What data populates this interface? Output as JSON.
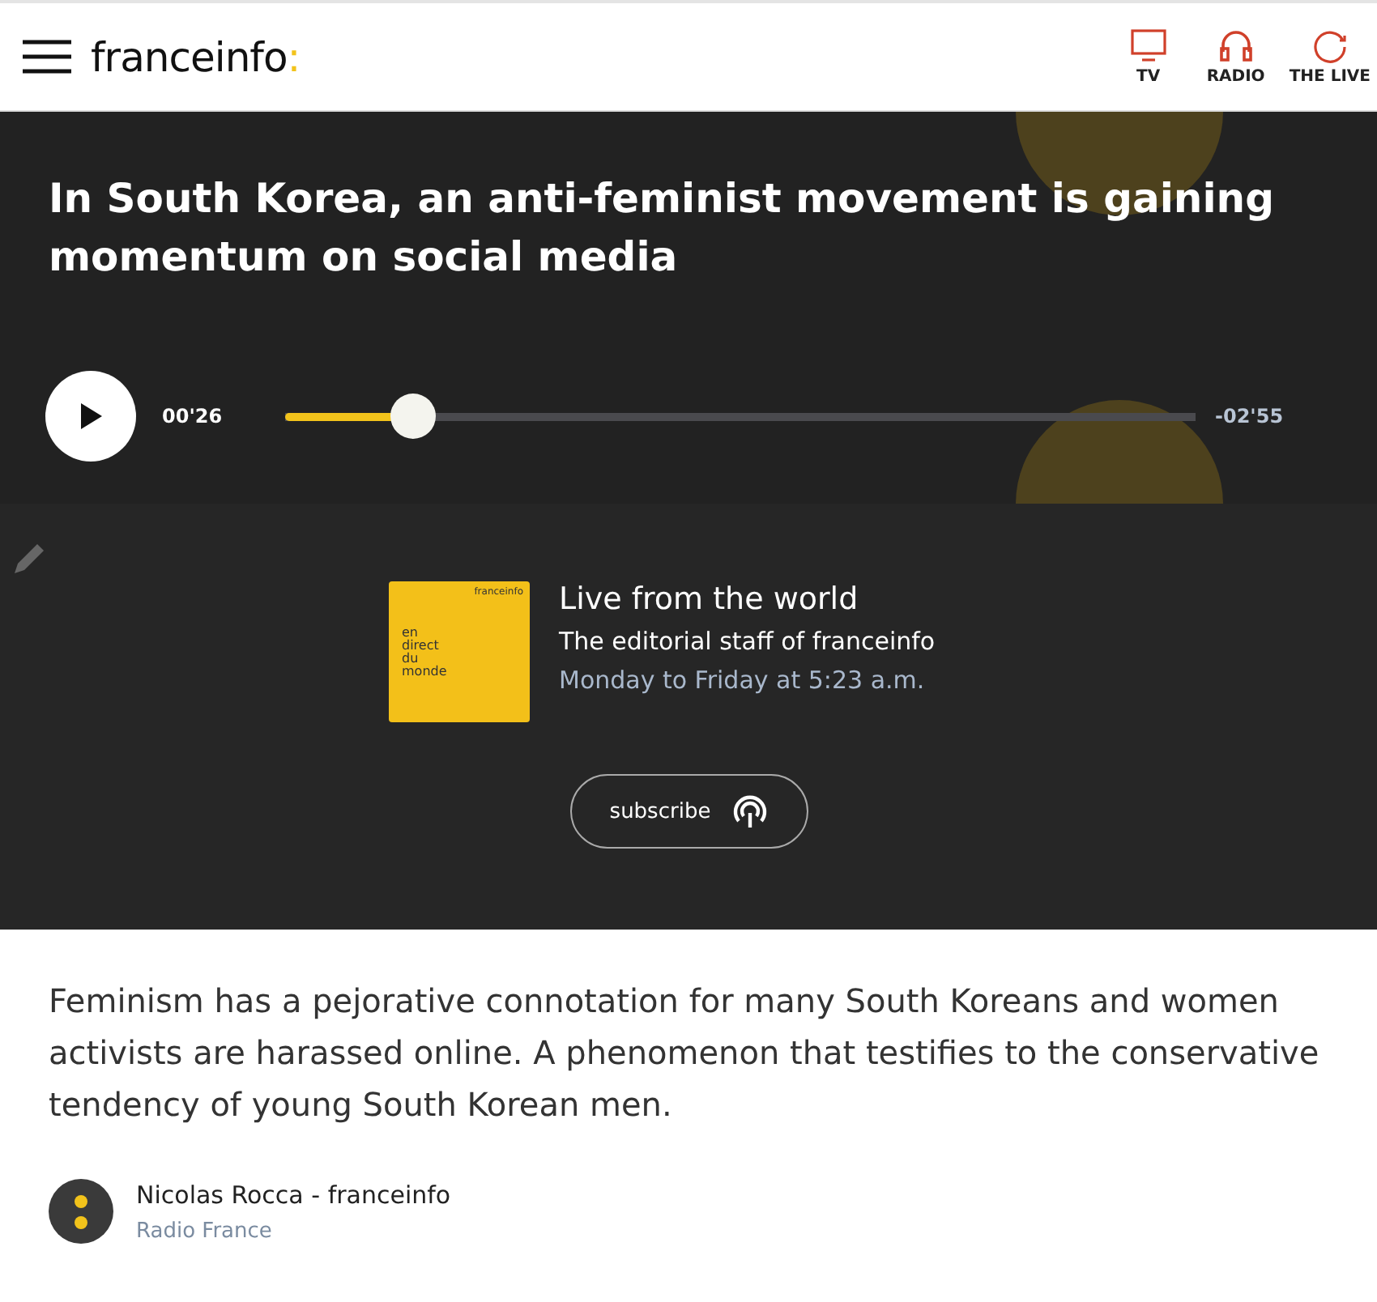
{
  "header": {
    "logo": "franceinfo",
    "logo_mark": ":",
    "nav": [
      {
        "label": "TV",
        "kind": "tv"
      },
      {
        "label": "RADIO",
        "kind": "radio"
      },
      {
        "label": "THE LIVE",
        "kind": "live"
      }
    ]
  },
  "hero": {
    "title": "In South Korea, an anti-feminist movement is gaining momentum on social media",
    "player": {
      "elapsed": "00'26",
      "remaining": "-02'55",
      "level": 0.14
    }
  },
  "podcast": {
    "cover": {
      "brand": "franceinfo",
      "title": [
        "en",
        "direct",
        "du",
        "monde"
      ]
    },
    "name": "Live from the world",
    "author": "The editorial staff of franceinfo",
    "schedule": "Monday to Friday at 5:23 a.m.",
    "subscribe": "subscribe"
  },
  "lead": "Feminism has a pejorative connotation for many South Koreans and women activists are harassed online. A phenomenon that testifies to the conservative tendency of young South Korean men.",
  "byline": {
    "author": "Nicolas Rocca - franceinfo",
    "org": "Radio France"
  }
}
